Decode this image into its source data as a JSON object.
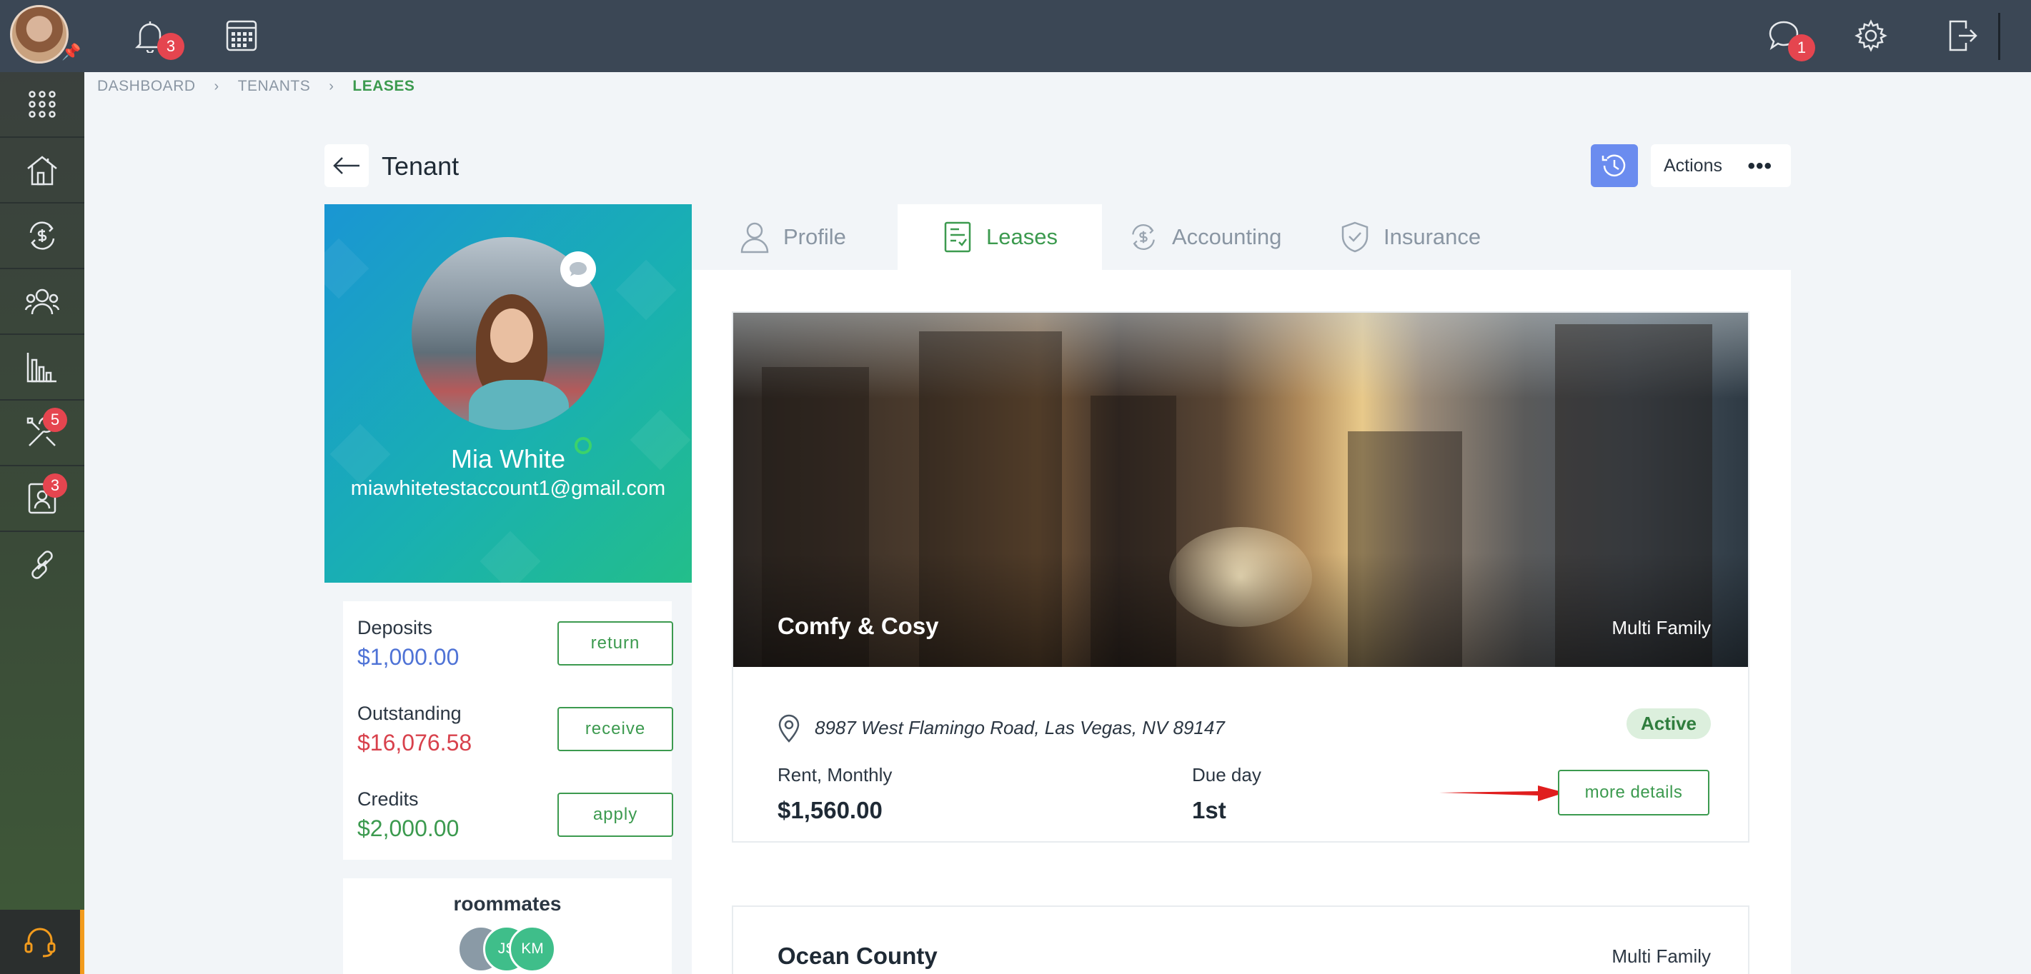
{
  "breadcrumb": {
    "items": [
      "DASHBOARD",
      "TENANTS",
      "LEASES"
    ]
  },
  "topbar": {
    "notifications_badge": "3",
    "messages_badge": "1",
    "icons": [
      "bell-icon",
      "calendar-icon",
      "chat-icon",
      "gear-icon",
      "logout-icon"
    ]
  },
  "sidebar": {
    "items": [
      {
        "name": "apps-grid",
        "icon": "grid-icon"
      },
      {
        "name": "properties",
        "icon": "house-icon"
      },
      {
        "name": "accounting",
        "icon": "dollar-cycle-icon"
      },
      {
        "name": "people",
        "icon": "people-icon"
      },
      {
        "name": "reports",
        "icon": "bar-chart-icon"
      },
      {
        "name": "maintenance",
        "icon": "tools-icon",
        "badge": "5"
      },
      {
        "name": "applications",
        "icon": "contact-card-icon",
        "badge": "3"
      },
      {
        "name": "integrations",
        "icon": "link-icon"
      }
    ],
    "support_icon": "headset-icon"
  },
  "header": {
    "title": "Tenant",
    "actions_label": "Actions"
  },
  "profile": {
    "name": "Mia White",
    "email": "miawhitetestaccount1@gmail.com"
  },
  "balances": {
    "deposits": {
      "label": "Deposits",
      "value": "$1,000.00",
      "button": "return",
      "color": "#4f73d6"
    },
    "outstanding": {
      "label": "Outstanding",
      "value": "$16,076.58",
      "button": "receive",
      "color": "#d8414c"
    },
    "credits": {
      "label": "Credits",
      "value": "$2,000.00",
      "button": "apply",
      "color": "#3c9a4f"
    }
  },
  "roommates": {
    "title": "roommates",
    "members": [
      {
        "initials": "",
        "color": "#8a9aa6"
      },
      {
        "initials": "JS",
        "color": "#3fbe8a"
      },
      {
        "initials": "KM",
        "color": "#3fbe8a"
      }
    ]
  },
  "tabs": [
    {
      "label": "Profile",
      "icon": "person-icon",
      "active": false
    },
    {
      "label": "Leases",
      "icon": "lease-doc-icon",
      "active": true
    },
    {
      "label": "Accounting",
      "icon": "dollar-cycle-icon",
      "active": false
    },
    {
      "label": "Insurance",
      "icon": "shield-icon",
      "active": false
    }
  ],
  "leases": [
    {
      "name": "Comfy & Cosy",
      "type": "Multi Family",
      "address": "8987 West Flamingo Road, Las Vegas, NV 89147",
      "status": "Active",
      "rent_label": "Rent, Monthly",
      "rent_value": "$1,560.00",
      "due_label": "Due day",
      "due_value": "1st",
      "details_button": "more details"
    },
    {
      "name": "Ocean County",
      "type": "Multi Family"
    }
  ],
  "colors": {
    "accent_green": "#3c9a4f",
    "topbar": "#3b4755",
    "history_button": "#6b8cef",
    "badge_red": "#e5454f",
    "arrow_red": "#e01e1e"
  }
}
